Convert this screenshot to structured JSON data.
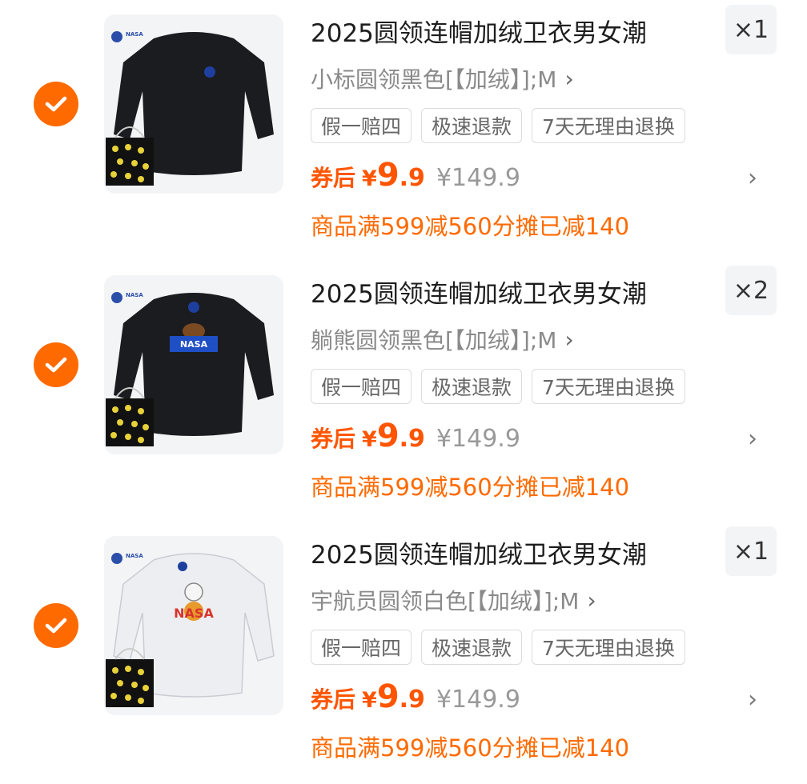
{
  "colors": {
    "accent": "#ff6a00",
    "price": "#ff5500",
    "muted": "#8a8a8a"
  },
  "items": [
    {
      "title": "2025圆领连帽加绒卫衣男女潮",
      "qty": "×1",
      "sku": "小标圆领黑色[【加绒】];M",
      "tags": [
        "假一赔四",
        "极速退款",
        "7天无理由退换"
      ],
      "price_label": "券后",
      "price_yen": "¥",
      "price_int": "9",
      "price_dec": ".9",
      "orig_price": "¥149.9",
      "promo": "商品满599减560分摊已减140",
      "image": {
        "kind": "black sweatshirt with small logo",
        "brand": "NASA"
      }
    },
    {
      "title": "2025圆领连帽加绒卫衣男女潮",
      "qty": "×2",
      "sku": "躺熊圆领黑色[【加绒】];M",
      "tags": [
        "假一赔四",
        "极速退款",
        "7天无理由退换"
      ],
      "price_label": "券后",
      "price_yen": "¥",
      "price_int": "9",
      "price_dec": ".9",
      "orig_price": "¥149.9",
      "promo": "商品满599减560分摊已减140",
      "image": {
        "kind": "black sweatshirt with bear logo",
        "brand": "NASA"
      }
    },
    {
      "title": "2025圆领连帽加绒卫衣男女潮",
      "qty": "×1",
      "sku": "宇航员圆领白色[【加绒】];M",
      "tags": [
        "假一赔四",
        "极速退款",
        "7天无理由退换"
      ],
      "price_label": "券后",
      "price_yen": "¥",
      "price_int": "9",
      "price_dec": ".9",
      "orig_price": "¥149.9",
      "promo": "商品满599减560分摊已减140",
      "image": {
        "kind": "white sweatshirt with astronaut",
        "brand": "NASA"
      }
    }
  ]
}
